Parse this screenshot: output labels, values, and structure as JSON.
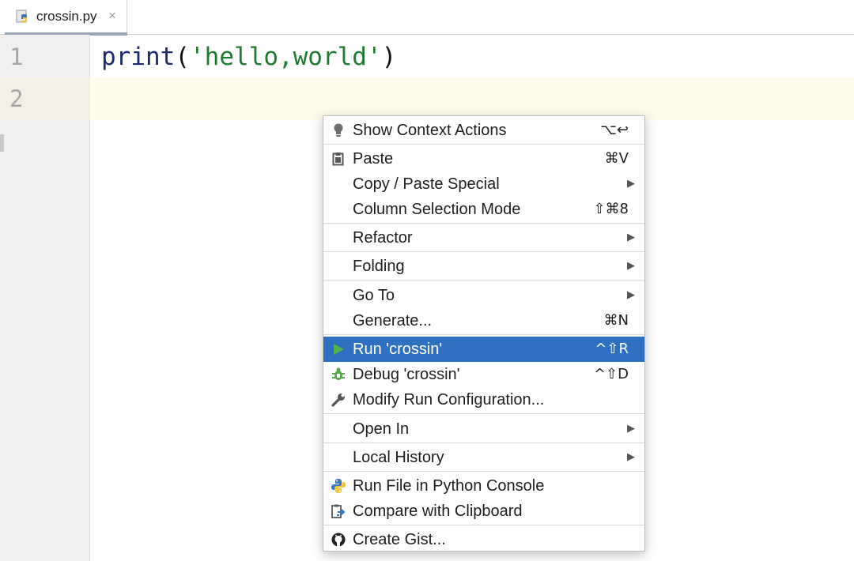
{
  "tab": {
    "filename": "crossin.py",
    "close_glyph": "×",
    "icon": "python-file-icon"
  },
  "editor": {
    "line_numbers": [
      "1",
      "2"
    ],
    "code": {
      "fn": "print",
      "open": "(",
      "string": "'hello,world'",
      "close": ")"
    },
    "colors": {
      "keyword": "#1c2a6e",
      "string": "#1e7a2e",
      "current_line": "#fffbea"
    }
  },
  "menu": {
    "accent": "#2f71c0",
    "items": [
      {
        "label": "Show Context Actions",
        "shortcut": "⌥↩",
        "icon": "lightbulb-icon"
      },
      {
        "label": "Paste",
        "shortcut": "⌘V",
        "icon": "clipboard-icon"
      },
      {
        "label": "Copy / Paste Special",
        "submenu": "▶"
      },
      {
        "label": "Column Selection Mode",
        "shortcut": "⇧⌘8"
      },
      {
        "label": "Refactor",
        "submenu": "▶"
      },
      {
        "label": "Folding",
        "submenu": "▶"
      },
      {
        "label": "Go To",
        "submenu": "▶"
      },
      {
        "label": "Generate...",
        "shortcut": "⌘N"
      },
      {
        "label": "Run 'crossin'",
        "shortcut": "^⇧R",
        "icon": "run-icon",
        "selected": true
      },
      {
        "label": "Debug 'crossin'",
        "shortcut": "^⇧D",
        "icon": "debug-icon"
      },
      {
        "label": "Modify Run Configuration...",
        "icon": "wrench-icon"
      },
      {
        "label": "Open In",
        "submenu": "▶"
      },
      {
        "label": "Local History",
        "submenu": "▶"
      },
      {
        "label": "Run File in Python Console",
        "icon": "python-icon"
      },
      {
        "label": "Compare with Clipboard",
        "icon": "compare-clipboard-icon"
      },
      {
        "label": "Create Gist...",
        "icon": "github-icon"
      }
    ]
  }
}
